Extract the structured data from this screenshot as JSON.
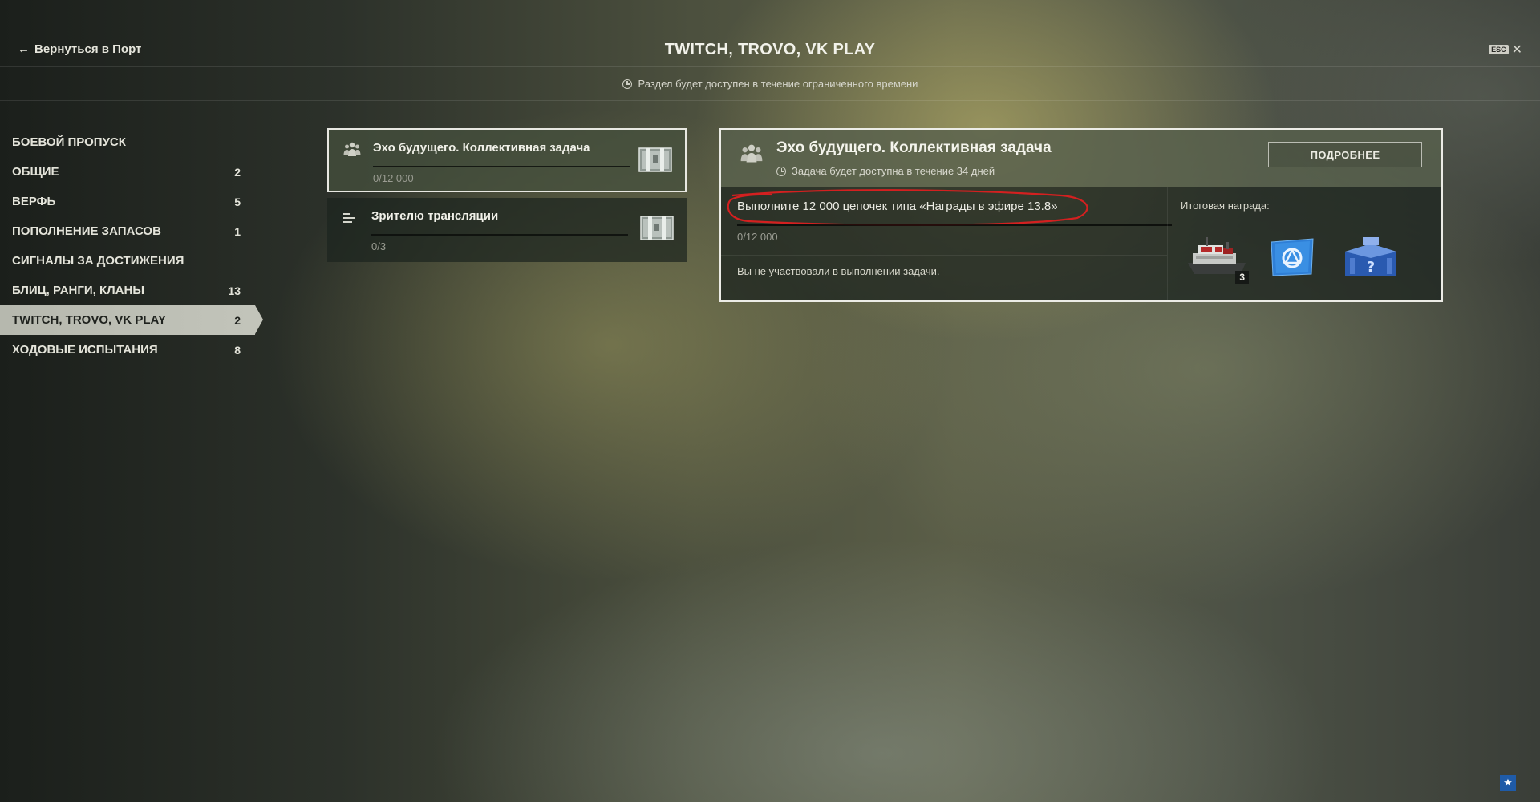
{
  "header": {
    "back_label": "Вернуться в Порт",
    "title": "TWITCH, TROVO, VK PLAY",
    "esc_label": "ESC",
    "close_symbol": "✕"
  },
  "notice": {
    "text": "Раздел будет доступен в течение ограниченного времени"
  },
  "sidebar": {
    "items": [
      {
        "label": "БОЕВОЙ ПРОПУСК",
        "count": ""
      },
      {
        "label": "ОБЩИЕ",
        "count": "2"
      },
      {
        "label": "ВЕРФЬ",
        "count": "5"
      },
      {
        "label": "ПОПОЛНЕНИЕ ЗАПАСОВ",
        "count": "1"
      },
      {
        "label": "СИГНАЛЫ ЗА ДОСТИЖЕНИЯ",
        "count": ""
      },
      {
        "label": "БЛИЦ, РАНГИ, КЛАНЫ",
        "count": "13"
      },
      {
        "label": "TWITCH, TROVO, VK PLAY",
        "count": "2",
        "active": true
      },
      {
        "label": "ХОДОВЫЕ ИСПЫТАНИЯ",
        "count": "8"
      }
    ]
  },
  "tasks": [
    {
      "name": "Эхо будущего. Коллективная задача",
      "progress": "0/12 000",
      "icon": "group-icon",
      "selected": true
    },
    {
      "name": "Зрителю трансляции",
      "progress": "0/3",
      "icon": "list-icon",
      "selected": false
    }
  ],
  "detail": {
    "title": "Эхо будущего. Коллективная задача",
    "subtitle": "Задача будет доступна в течение 34 дней",
    "more_button": "ПОДРОБНЕЕ",
    "objective": "Выполните 12 000 цепочек типа «Награды в эфире 13.8»",
    "progress": "0/12 000",
    "progress_fraction": 0,
    "note": "Вы не участвовали в выполнении задачи.",
    "reward_label": "Итоговая награда:",
    "rewards": [
      {
        "icon": "ship-reward-icon",
        "quantity": "3"
      },
      {
        "icon": "blue-flag-icon",
        "quantity": ""
      },
      {
        "icon": "mystery-container-icon",
        "quantity": ""
      }
    ]
  },
  "colors": {
    "annotation_red": "#d42020",
    "accent_blue": "#1f5ba8",
    "selected_border": "#e8e8e2"
  },
  "corner_icon": "star-icon"
}
